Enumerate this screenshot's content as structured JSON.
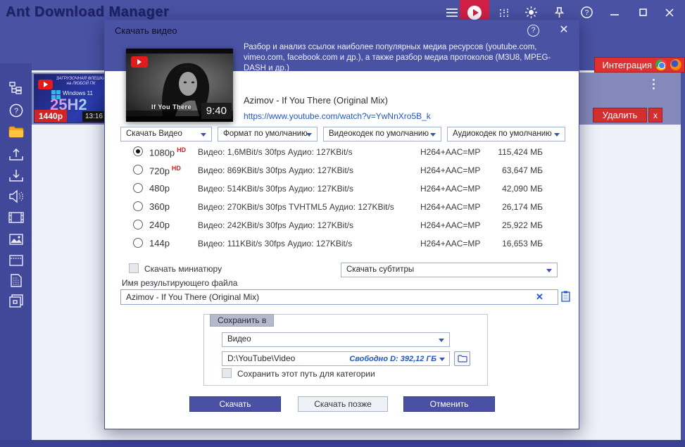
{
  "colors": {
    "header_blue": "#4a52a4",
    "accent_red": "#d32f2f",
    "play_tile_red": "#d12045",
    "link_blue": "#2156c8",
    "selected_row": "#8389bb"
  },
  "window": {
    "title": "Ant Download Manager",
    "toolbar_icons": [
      "menu-icon",
      "play-icon",
      "stats-icon",
      "theme-icon",
      "pin-icon",
      "help-icon",
      "minimize-icon",
      "maximize-icon",
      "close-icon"
    ]
  },
  "sidebar": {
    "icons": [
      "scheme-icon",
      "help-icon",
      "folder-icon",
      "upload-icon",
      "download-icon",
      "audio-icon",
      "video-icon",
      "image-icon",
      "browser-icon",
      "document-icon",
      "archive-icon"
    ]
  },
  "integration": {
    "label": "Интеграция"
  },
  "list_item": {
    "thumb_line1": "ЗАГРУЗОЧНАЯ ФЛЕШКА",
    "thumb_line2": "на ЛЮБОЙ ПК",
    "thumb_os": "Windows 11",
    "thumb_version": "25H2",
    "resolution_badge": "1440p",
    "duration": "13:16",
    "delete_label": "Удалить",
    "close_label": "x"
  },
  "dialog": {
    "title": "Скачать видео",
    "description": "Разбор и анализ ссылок наиболее популярных медиа ресурсов (youtube.com, vimeo.com, facebook.com и др.), а также разбор медиа протоколов (M3U8, MPEG-DASH и др.)",
    "video": {
      "title": "Azimov - If You There (Original Mix)",
      "url": "https://www.youtube.com/watch?v=YwNnXro5B_k",
      "duration": "9:40",
      "thumb_caption": "If You There"
    },
    "dropdowns": {
      "action": "Скачать Видео",
      "format": "Формат по умолчанию",
      "vcodec": "Видеокодек по умолчанию",
      "acodec": "Аудиокодек по умолчанию",
      "subtitles": "Скачать субтитры",
      "category": "Видео"
    },
    "qualities": [
      {
        "label": "1080p",
        "hd": "HD",
        "selected": true,
        "info": "Видео: 1,6MBit/s 30fps Аудио: 127KBit/s",
        "codec": "H264+AAC=MP",
        "size": "115,424 МБ"
      },
      {
        "label": "720p",
        "hd": "HD",
        "selected": false,
        "info": "Видео: 869KBit/s 30fps Аудио: 127KBit/s",
        "codec": "H264+AAC=MP",
        "size": "63,647 МБ"
      },
      {
        "label": "480p",
        "selected": false,
        "info": "Видео: 514KBit/s 30fps Аудио: 127KBit/s",
        "codec": "H264+AAC=MP",
        "size": "42,090 МБ"
      },
      {
        "label": "360p",
        "selected": false,
        "info": "Видео: 270KBit/s 30fps TVHTML5 Аудио: 127KBit/s",
        "codec": "H264+AAC=MP",
        "size": "26,174 МБ"
      },
      {
        "label": "240p",
        "selected": false,
        "info": "Видео: 242KBit/s 30fps Аудио: 127KBit/s",
        "codec": "H264+AAC=MP",
        "size": "25,922 МБ"
      },
      {
        "label": "144p",
        "selected": false,
        "info": "Видео: 111KBit/s 30fps Аудио: 127KBit/s",
        "codec": "H264+AAC=MP",
        "size": "16,653 МБ"
      }
    ],
    "thumbnail_checkbox_label": "Скачать миниатюру",
    "filename_label": "Имя результирующего файла",
    "filename_value": "Azimov - If You There (Original Mix)",
    "save_group": {
      "title": "Сохранить в",
      "category": "Видео",
      "path": "D:\\YouTube\\Video",
      "free_space": "Свободно D: 392,12 ГБ",
      "save_path_checkbox_label": "Сохранить этот путь для категории"
    },
    "buttons": {
      "download": "Скачать",
      "later": "Скачать позже",
      "cancel": "Отменить"
    }
  }
}
